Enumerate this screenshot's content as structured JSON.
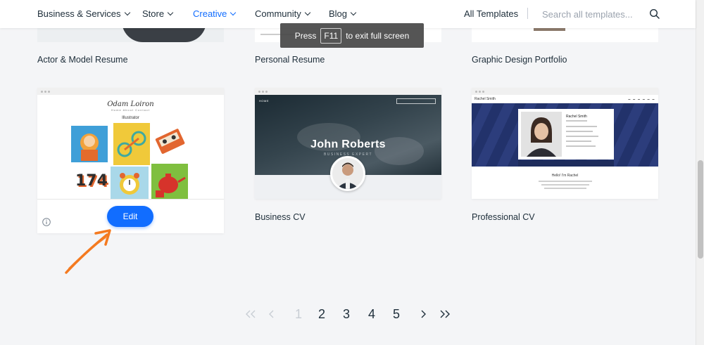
{
  "nav": {
    "items": [
      {
        "label": "Business & Services"
      },
      {
        "label": "Store"
      },
      {
        "label": "Creative"
      },
      {
        "label": "Community"
      },
      {
        "label": "Blog"
      }
    ],
    "all_templates": "All Templates",
    "search_placeholder": "Search all templates...",
    "active_color": "#116dff"
  },
  "toast": {
    "press": "Press",
    "key": "F11",
    "rest": "to exit full screen"
  },
  "templates": {
    "row1": [
      {
        "title": "Actor & Model Resume"
      },
      {
        "title": "Personal Resume"
      },
      {
        "title": "Graphic Design Portfolio"
      }
    ],
    "illustrator": {
      "logo": "Odam Loiron",
      "menu": "Home   About   Contact",
      "heading": "Illustrator",
      "tile_number": "174",
      "edit_label": "Edit"
    },
    "business_cv": {
      "title": "Business CV",
      "nav_home": "HOME",
      "name": "John Roberts",
      "subtitle": "BUSINESS EXPERT"
    },
    "professional_cv": {
      "title": "Professional CV",
      "top_name": "Rachel Smith",
      "panel_name": "Rachel Smith",
      "hello": "Hello! I'm Rachel"
    }
  },
  "pagination": {
    "pages": [
      "1",
      "2",
      "3",
      "4",
      "5"
    ],
    "current": "1"
  },
  "colors": {
    "accent": "#116dff",
    "annotation": "#f47a20",
    "pro_banner": "#22326b"
  }
}
